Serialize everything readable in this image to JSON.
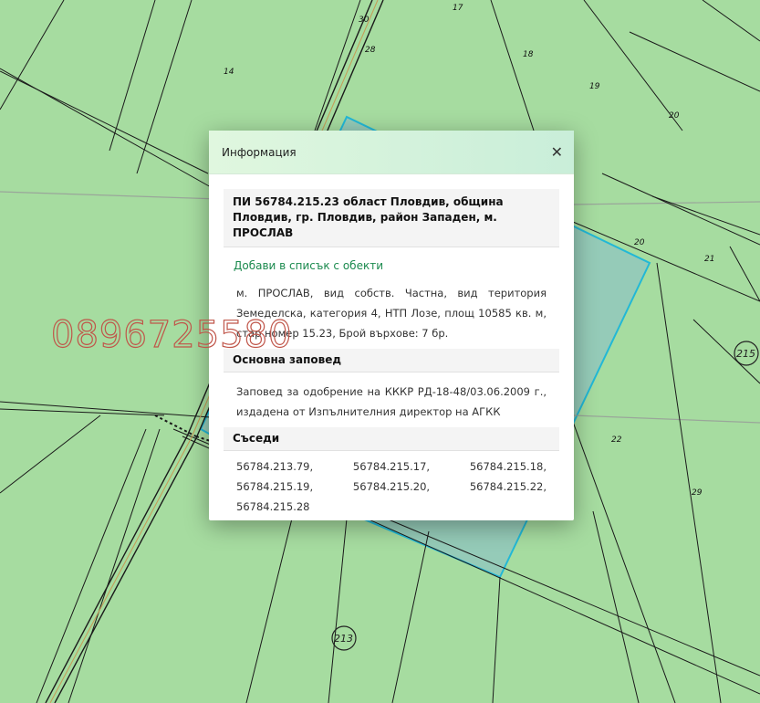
{
  "map": {
    "parcel_numbers": [
      "30",
      "17",
      "28",
      "18",
      "14",
      "19",
      "20",
      "20",
      "21",
      "22",
      "29"
    ],
    "road_numbers": [
      "215",
      "213"
    ],
    "colors": {
      "ground": "#a6dca0",
      "selected_parcel_stroke": "#22b8d6",
      "selected_parcel_fill": "#8fc6c0"
    }
  },
  "watermark": {
    "text": "0896725580"
  },
  "popup": {
    "title": "Информация",
    "close_icon": "close-icon",
    "parcel_heading": "ПИ 56784.215.23 област Пловдив, община Пловдив, гр. Пловдив, район Западен, м. ПРОСЛАВ",
    "add_link": "Добави в списък с обекти",
    "description": "м. ПРОСЛАВ, вид собств. Частна, вид територия Земеделска, категория 4, НТП Лозе, площ 10585 кв. м, стар номер 15.23, Брой върхове: 7 бр.",
    "order_heading": "Основна заповед",
    "order_text": "Заповед за одобрение на КККР РД-18-48/03.06.2009 г., издадена от Изпълнителния директор на АГКК",
    "neighbors_heading": "Съседи",
    "neighbors_text": "56784.213.79, 56784.215.17, 56784.215.18, 56784.215.19, 56784.215.20, 56784.215.22, 56784.215.28"
  }
}
